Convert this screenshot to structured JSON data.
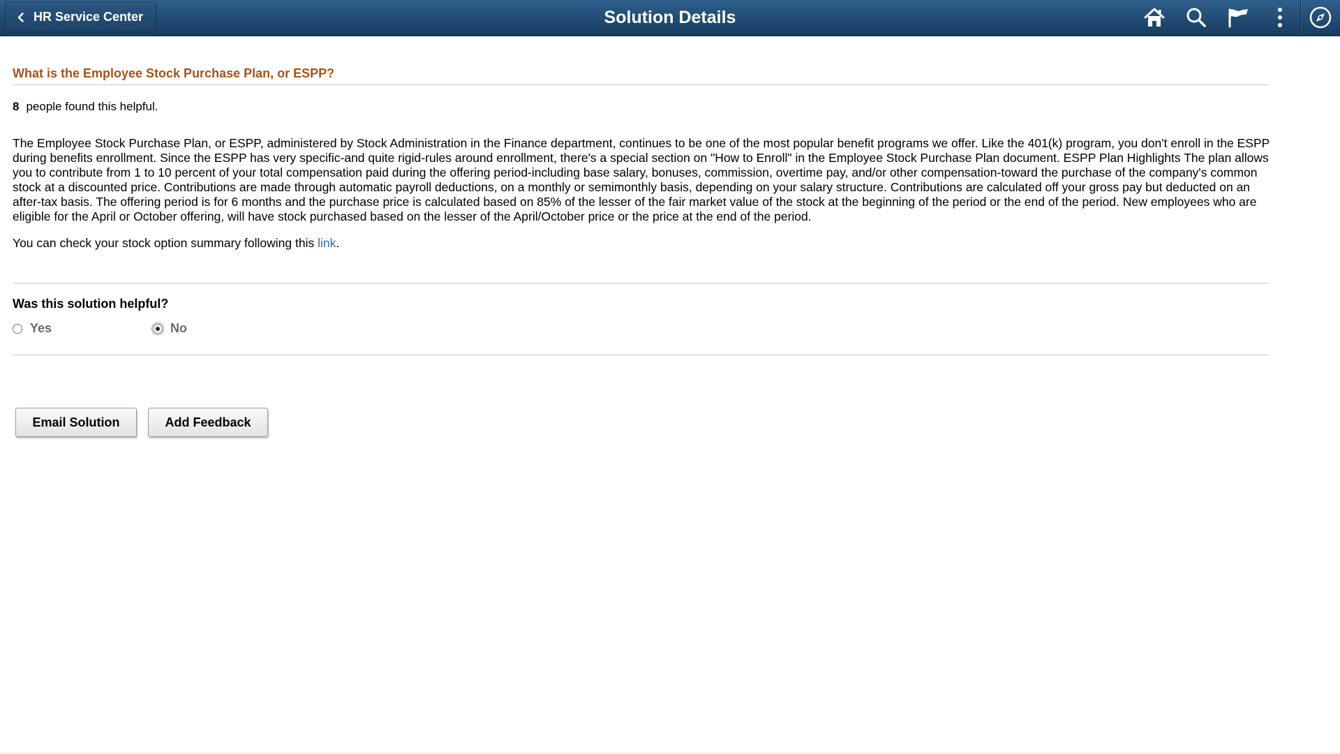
{
  "header": {
    "back_label": "HR Service Center",
    "title": "Solution Details",
    "background_color": "#214b73",
    "icons": [
      "home-icon",
      "search-icon",
      "flag-icon",
      "more-actions-icon",
      "navbar-compass-icon"
    ]
  },
  "solution": {
    "title": "What is the Employee Stock Purchase Plan, or ESPP?",
    "title_color": "#a3541b",
    "helpful_count": "8",
    "helpful_text": "people found this helpful.",
    "body": "The Employee Stock Purchase Plan, or ESPP, administered by Stock Administration in the Finance department, continues to be one of the most popular benefit programs we offer. Like the 401(k) program, you don't enroll in the ESPP during benefits enrollment. Since the ESPP has very specific-and quite rigid-rules around enrollment, there's a special section on \"How to Enroll\" in the Employee Stock Purchase Plan document. ESPP Plan Highlights The plan allows you to contribute from 1 to 10 percent of your total compensation paid during the offering period-including base salary, bonuses, commission, overtime pay, and/or other compensation-toward the purchase of the company's common stock at a discounted price. Contributions are made through automatic payroll deductions, on a monthly or semimonthly basis, depending on your salary structure. Contributions are calculated off your gross pay but deducted on an after-tax basis. The offering period is for 6 months and the purchase price is calculated based on 85% of the lesser of the fair market value of the stock at the beginning of the period or the end of the period. New employees who are eligible for the April or October offering, will have stock purchased based on the lesser of the April/October price or the price at the end of the period.",
    "link_prefix": "You can check your stock option summary following this ",
    "link_text": "link",
    "link_suffix": ".",
    "link_color": "#2f69b8"
  },
  "feedback": {
    "question": "Was this solution helpful?",
    "options": [
      {
        "label": "Yes",
        "selected": false
      },
      {
        "label": "No",
        "selected": true
      }
    ]
  },
  "actions": {
    "email_label": "Email Solution",
    "feedback_label": "Add Feedback"
  }
}
